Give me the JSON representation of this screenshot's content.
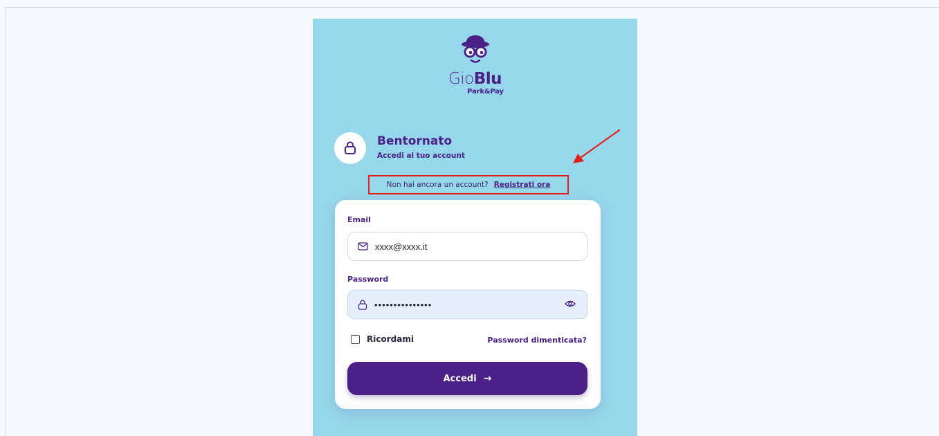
{
  "brand": {
    "name_light": "Gio",
    "name_bold": "Blu",
    "tagline": "Park&Pay",
    "color": "#4b2187"
  },
  "header": {
    "title": "Bentornato",
    "subtitle": "Accedi al tuo account",
    "icon": "lock-icon"
  },
  "register": {
    "prompt": "Non hai ancora un account?",
    "link": "Registrati ora",
    "highlight_color": "#e2201b"
  },
  "form": {
    "email": {
      "label": "Email",
      "value": "xxxx@xxxx.it",
      "icon": "mail-icon"
    },
    "password": {
      "label": "Password",
      "value": "•••••••••••••••",
      "icon": "lock-icon",
      "toggle_icon": "eye-icon"
    },
    "remember_label": "Ricordami",
    "remember_checked": false,
    "forgot_label": "Password dimenticata?",
    "submit_label": "Accedi",
    "submit_icon": "arrow-right-icon"
  },
  "colors": {
    "background": "#97d7ec",
    "accent": "#4b2187",
    "annotation": "#e2201b"
  }
}
